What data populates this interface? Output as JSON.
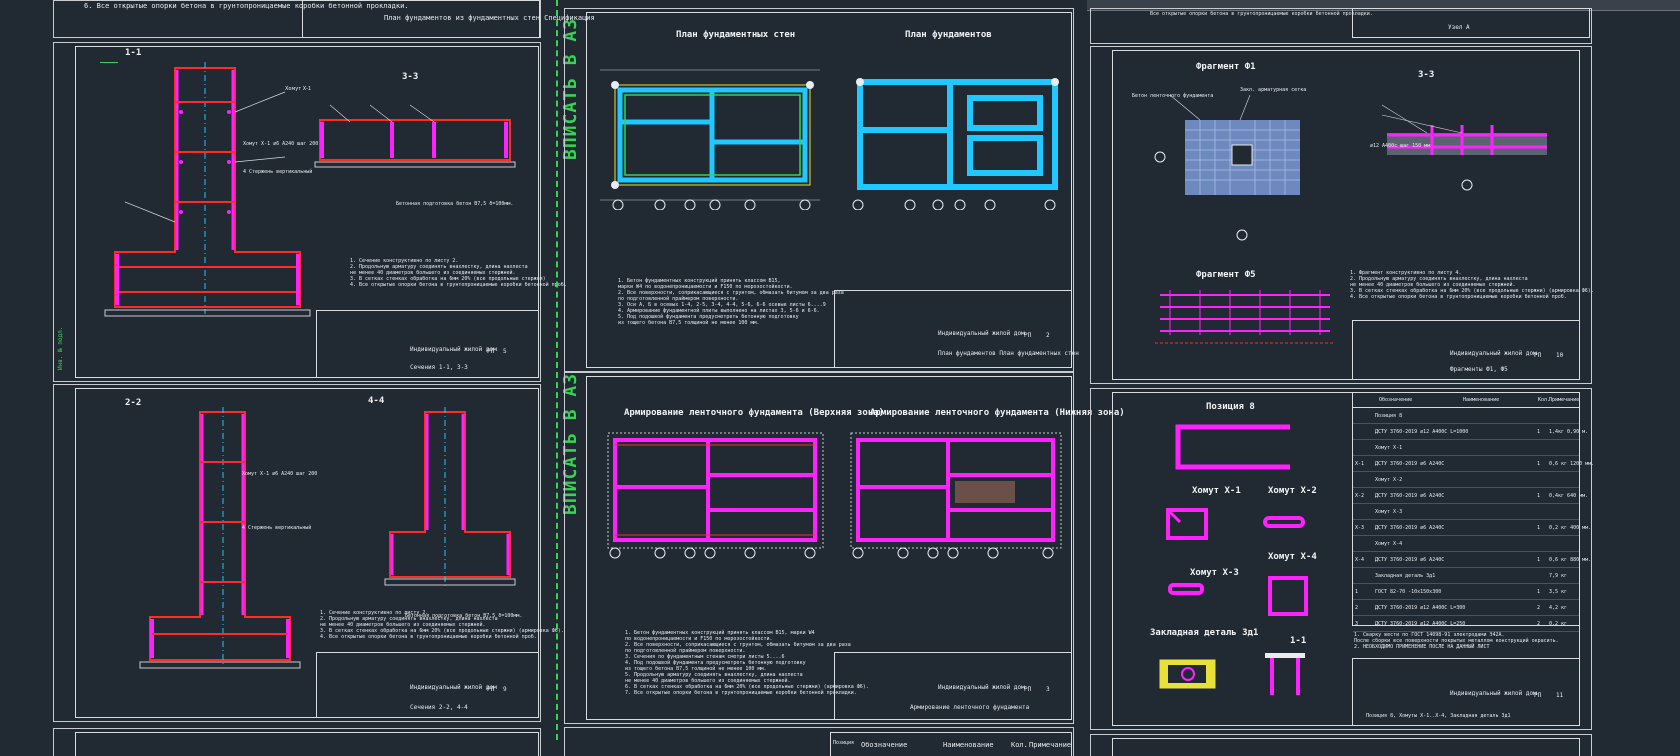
{
  "colors": {
    "bg": "#212932",
    "line": "#d9dde0",
    "rebar": "#ff22ff",
    "red": "#ff2a2a",
    "cyan": "#20c8ff",
    "green": "#39d353",
    "yellow": "#e7e13a",
    "white": "#e8ecef"
  },
  "top_left_note": "6. Все открытые опорки бетона в грунтопроницаемые коробки бетонной прокладки.",
  "top_left_title": "План фундаментов из фундаментных стен Спецификация",
  "top_right_note": "Все открытые опорки бетона в грунтопроницаемые коробки бетонной прокладки.",
  "top_right_title": "Узел А",
  "stamp_A3": "ВПИСАТЬ В А3",
  "side_label": "Инв. № подл.",
  "sheets": {
    "s1": {
      "section_title": "1-1",
      "section_right": "3-3",
      "notes": [
        "1. Сечение конструктивно по листу 2.",
        "2. Продольную арматуру соединять внахлестку, длина нахлеста",
        "   не менее 40 диаметров большего из соединяемых стержней.",
        "3. В сетках стенках обработка на 6мм 20% (все продольные стержни)",
        "4. Все открытые опорки бетона в грунтопроницаемые коробки бетонной проб."
      ],
      "label_a": "Хомут Х-1 ⌀6 А240 шаг 200",
      "label_b": "4 Стержень вертикальный",
      "label_c": "Бетонная подготовка бетон В7,5 δ=100мм.",
      "tb_project": "Индивидуальный жилой дом",
      "tb_sheet": "5",
      "tb_title": "Сечения 1-1, 3-3",
      "tb_stage": "РП"
    },
    "s2": {
      "title_left": "План фундаментных стен",
      "title_right": "План фундаментов",
      "notes": [
        "1. Бетон фундаментных конструкций принять классом В15,",
        "   марки W4 по водонепроницаемости и F150 по морозостойкости.",
        "2. Все поверхности, соприкасающиеся с грунтом, обмазать битумом за два раза",
        "   по подготовленной праймером поверхности.",
        "3. Оси А, Б в осевых 1-4, 2-5, 3-4, 4-4, 5-6, 6-6 осевые листы 6....9",
        "4. Армирование фундаментной плиты выполнено на листах 3, 5-6 и 6-6.",
        "5. Под подошвой фундамента предусмотреть бетонную подготовку",
        "   из тощего бетона В7,5 толщиной не менее 100 мм."
      ],
      "tb_project": "Индивидуальный жилой дом",
      "tb_sheet": "2",
      "tb_title": "План фундаментов План фундаментных стен",
      "tb_stage": "РП"
    },
    "s3": {
      "title": "Фрагмент Ф1",
      "section": "3-3",
      "label_a": "Бетон ленточного фундамента",
      "label_b": "Закл. арматурная сетка",
      "label_c": "⌀12 А400с шаг 150 мм",
      "sub_title": "Фрагмент Ф5",
      "notes": [
        "1. Фрагмент конструктивно по листу 4.",
        "2. Продольную арматуру соединять внахлестку, длина нахлеста",
        "   не менее 40 диаметров большего из соединяемых стержней.",
        "3. В сетках стенках обработка на 6мм 20% (все продольные стержни) (армировка Ф6).",
        "4. Все открытые опорки бетона в грунтопроницаемые коробки бетонной проб."
      ],
      "tb_project": "Индивидуальный жилой дом",
      "tb_sheet": "10",
      "tb_title": "Фрагменты Ф1, Ф5",
      "tb_stage": "РП"
    },
    "s4": {
      "section_title": "2-2",
      "section_right": "4-4",
      "notes": [
        "1. Сечение конструктивно по листу 2.",
        "2. Продольную арматуру соединять внахлестку, длина нахлеста",
        "   не менее 40 диаметров большего из соединяемых стержней.",
        "3. В сетках стенках обработка на 6мм 20% (все продольные стержни) (армировка Ф6).",
        "4. Все открытые опорки бетона в грунтопроницаемые коробки бетонной проб."
      ],
      "label_a": "Хомут Х-1 ⌀6 А240 шаг 200",
      "label_b": "4 Стержень вертикальный",
      "label_c": "Бетонная подготовка бетон В7,5 δ=100мм.",
      "tb_project": "Индивидуальный жилой дом",
      "tb_sheet": "9",
      "tb_title": "Сечения 2-2, 4-4",
      "tb_stage": "РП"
    },
    "s5": {
      "title_left": "Армирование ленточного фундамента (Верхняя зона)",
      "title_right": "Армирование ленточного фундамента (Нижняя зона)",
      "notes": [
        "1. Бетон фундаментных конструкций принять классом В15, марки W4",
        "   по водонепроницаемости и F150 по морозостойкости.",
        "2. Все поверхности, соприкасающиеся с грунтом, обмазать битумом за два раза",
        "   по подготовленной праймером поверхности.",
        "3. Сечения по фундаментным стенам смотри листы 5....6",
        "4. Под подошвой фундамента предусмотреть бетонную подготовку",
        "   из тощего бетона В7,5 толщиной не менее 100 мм.",
        "5. Продольную арматуру соединять внахлестку, длина нахлеста",
        "   не менее 40 диаметров большего из соединяемых стержней.",
        "6. В сетках стенках обработка на 6мм 20% (все продольные стержни) (армировка Ф6).",
        "7. Все открытые опорки бетона в грунтопроницаемые коробки бетонной прокладки."
      ],
      "tb_project": "Индивидуальный жилой дом",
      "tb_sheet": "3",
      "tb_title": "Армирование ленточного фундамента",
      "tb_stage": "РП"
    },
    "s6": {
      "pos_title": "Позиция 8",
      "h1": "Хомут Х-1",
      "h2": "Хомут Х-2",
      "h3": "Хомут Х-3",
      "h4": "Хомут Х-4",
      "detail": "Закладная деталь Зд1",
      "detail_sec": "1-1",
      "spec_headers": [
        "Обозначение",
        "Наименование",
        "Кол.",
        "Примечание"
      ],
      "spec_rows": [
        [
          "",
          "Позиция 8",
          "",
          ""
        ],
        [
          "",
          "ДСТУ 3760-2019 ⌀12 А400С L=1000",
          "1",
          "1,4кг 0,90 м."
        ],
        [
          "",
          "Хомут Х-1",
          "",
          ""
        ],
        [
          "Х-1",
          "ДСТУ 3760-2019 ⌀6 А240С",
          "1",
          "0,6 кг 1200 мм."
        ],
        [
          "",
          "Хомут Х-2",
          "",
          ""
        ],
        [
          "Х-2",
          "ДСТУ 3760-2019 ⌀6 А240С",
          "1",
          "0,4кг 640 мм."
        ],
        [
          "",
          "Хомут Х-3",
          "",
          ""
        ],
        [
          "Х-3",
          "ДСТУ 3760-2019 ⌀6 А240С",
          "1",
          "0,2 кг 400 мм."
        ],
        [
          "",
          "Хомут Х-4",
          "",
          ""
        ],
        [
          "Х-4",
          "ДСТУ 3760-2019 ⌀6 А240С",
          "1",
          "0,6 кг 880 мм."
        ],
        [
          "",
          "Закладная деталь Зд1",
          "",
          "7,9 кг"
        ],
        [
          "1",
          "ГОСТ 82-70 -10х150х300",
          "1",
          "3,5 кг"
        ],
        [
          "2",
          "ДСТУ 3760-2019 ⌀12 А400С L=300",
          "2",
          "4,2 кг"
        ],
        [
          "3",
          "ДСТУ 3760-2019 ⌀12 А400С L=250",
          "2",
          "0,2 кг"
        ]
      ],
      "notes": [
        "1. Сварку вести по ГОСТ 14098-91 электродами Э42А.",
        "   После сборки все поверхности покрытых металлом конструкций окрасить.",
        "2. НЕОБХОДИМО ПРИМЕНЕНИЕ ПОСЛЕ НА ДАННЫЙ ЛИСТ"
      ],
      "tb_project": "Индивидуальный жилой дом",
      "tb_sheet": "11",
      "tb_title": "Позиция 8, Хомуты Х-1..Х-4, Закладная деталь Зд1",
      "tb_stage": "РП"
    },
    "s7": {
      "headers": [
        "Позиция",
        "Обозначение",
        "Наименование",
        "Кол.",
        "Примечание"
      ]
    }
  }
}
